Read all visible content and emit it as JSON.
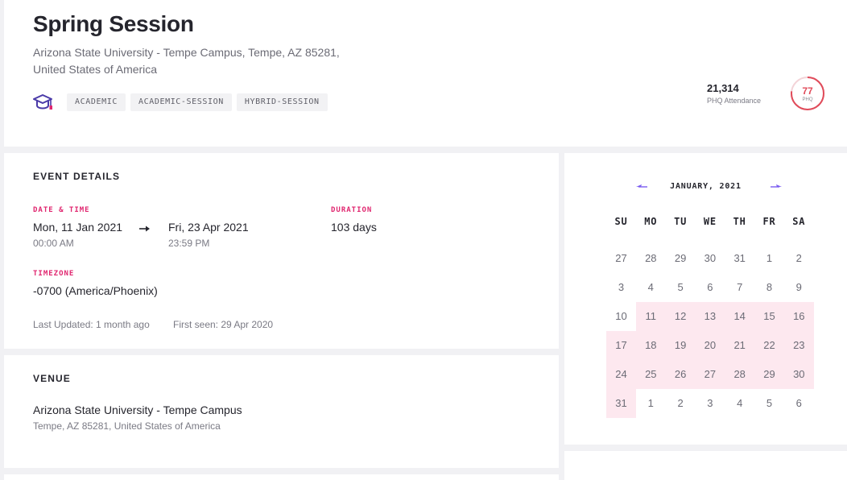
{
  "event": {
    "title": "Spring Session",
    "address": "Arizona State University - Tempe Campus, Tempe, AZ 85281, United States of America",
    "category_icon": "graduation-cap-icon",
    "tags": [
      "ACADEMIC",
      "ACADEMIC-SESSION",
      "HYBRID-SESSION"
    ],
    "attendance": "21,314",
    "attendance_label": "PHQ Attendance",
    "phq_rank": "77",
    "phq_label": "PHQ",
    "phq_rank_fraction": 0.77,
    "accent_color": "#e04b5a"
  },
  "details": {
    "section_title": "EVENT DETAILS",
    "date_time_label": "DATE & TIME",
    "start_date": "Mon, 11 Jan 2021",
    "start_time": "00:00 AM",
    "end_date": "Fri, 23 Apr 2021",
    "end_time": "23:59 PM",
    "duration_label": "DURATION",
    "duration": "103 days",
    "timezone_label": "TIMEZONE",
    "timezone": "-0700 (America/Phoenix)",
    "last_updated": "Last Updated: 1 month ago",
    "first_seen": "First seen: 29 Apr 2020"
  },
  "venue": {
    "section_title": "VENUE",
    "name": "Arizona State University - Tempe Campus",
    "address": "Tempe, AZ 85281, United States of America"
  },
  "calendar": {
    "month": "JANUARY, 2021",
    "weekdays": [
      "SU",
      "MO",
      "TU",
      "WE",
      "TH",
      "FR",
      "SA"
    ],
    "weeks": [
      [
        "27",
        "28",
        "29",
        "30",
        "31",
        "1",
        "2"
      ],
      [
        "3",
        "4",
        "5",
        "6",
        "7",
        "8",
        "9"
      ],
      [
        "10",
        "11",
        "12",
        "13",
        "14",
        "15",
        "16"
      ],
      [
        "17",
        "18",
        "19",
        "20",
        "21",
        "22",
        "23"
      ],
      [
        "24",
        "25",
        "26",
        "27",
        "28",
        "29",
        "30"
      ],
      [
        "31",
        "1",
        "2",
        "3",
        "4",
        "5",
        "6"
      ]
    ],
    "highlight_color": "#fde8ef"
  }
}
